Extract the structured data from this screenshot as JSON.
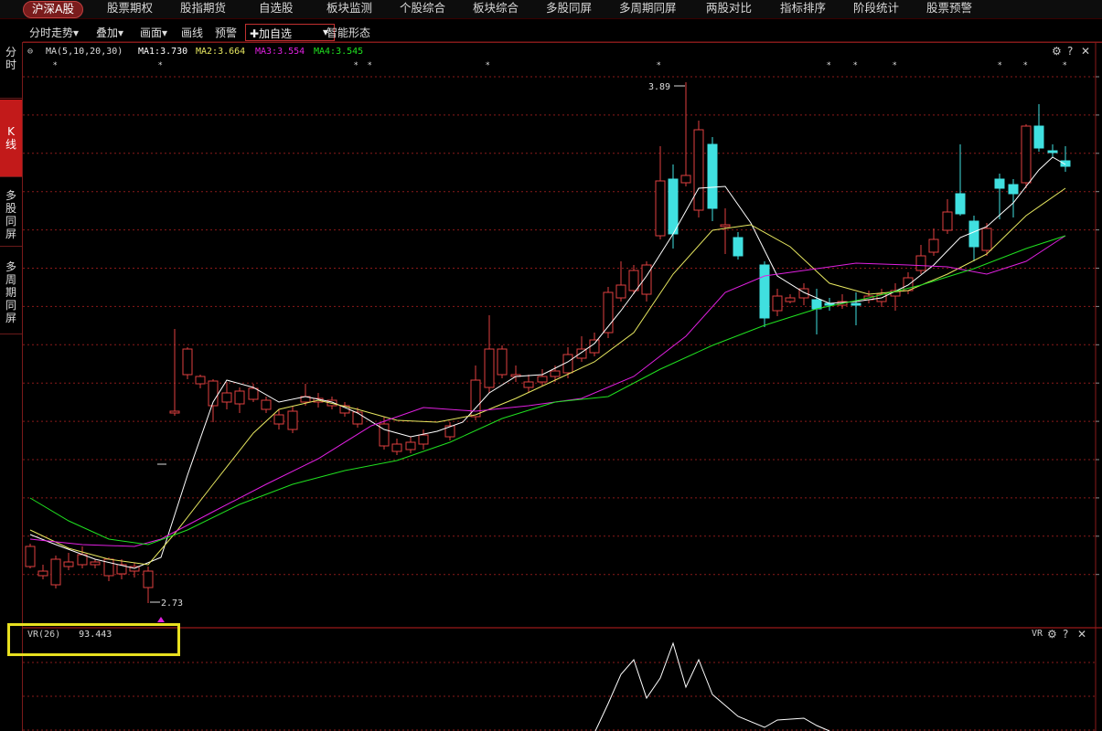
{
  "top_nav": {
    "tabs": [
      "沪深A股",
      "股票期权",
      "股指期货",
      "自选股",
      "板块监测",
      "个股综合",
      "板块综合",
      "多股同屏",
      "多周期同屏",
      "两股对比",
      "指标排序",
      "阶段统计",
      "股票预警"
    ],
    "active_index": 0
  },
  "toolbar": {
    "items": [
      "分时走势▾",
      "叠加▾",
      "画面▾",
      "画线",
      "预警"
    ],
    "add_favorite": "✚加自选",
    "add_favorite_arrow": "▾",
    "smart_pattern": "智能形态"
  },
  "sidebar": {
    "items": [
      "分时",
      "K线",
      "多股同屏",
      "多周期同屏"
    ],
    "active_index": 1
  },
  "ma_legend": {
    "label": "MA(5,10,20,30)",
    "ma1": "MA1:3.730",
    "ma2": "MA2:3.664",
    "ma3": "MA3:3.554",
    "ma4": "MA4:3.545"
  },
  "vr_legend": {
    "label": "VR(26)",
    "value": "93.443",
    "corner_label": "VR"
  },
  "annotations": {
    "high_label": "3.89",
    "low_label": "2.73"
  },
  "colors": {
    "up": "#e04040",
    "down": "#40e0e0",
    "ma1": "#ffffff",
    "ma2": "#e8e860",
    "ma3": "#e020e0",
    "ma4": "#20e020",
    "grid": "#8a1a1a",
    "highlight": "#e8e020",
    "active_tab": "#7a1c1c"
  },
  "chart_data": {
    "type": "candlestick",
    "high": 3.89,
    "low": 2.73,
    "series_names": [
      "MA1",
      "MA2",
      "MA3",
      "MA4"
    ],
    "ma_latest": [
      3.73,
      3.664,
      3.554,
      3.545
    ],
    "indicator": {
      "name": "VR(26)",
      "latest": 93.443
    }
  }
}
